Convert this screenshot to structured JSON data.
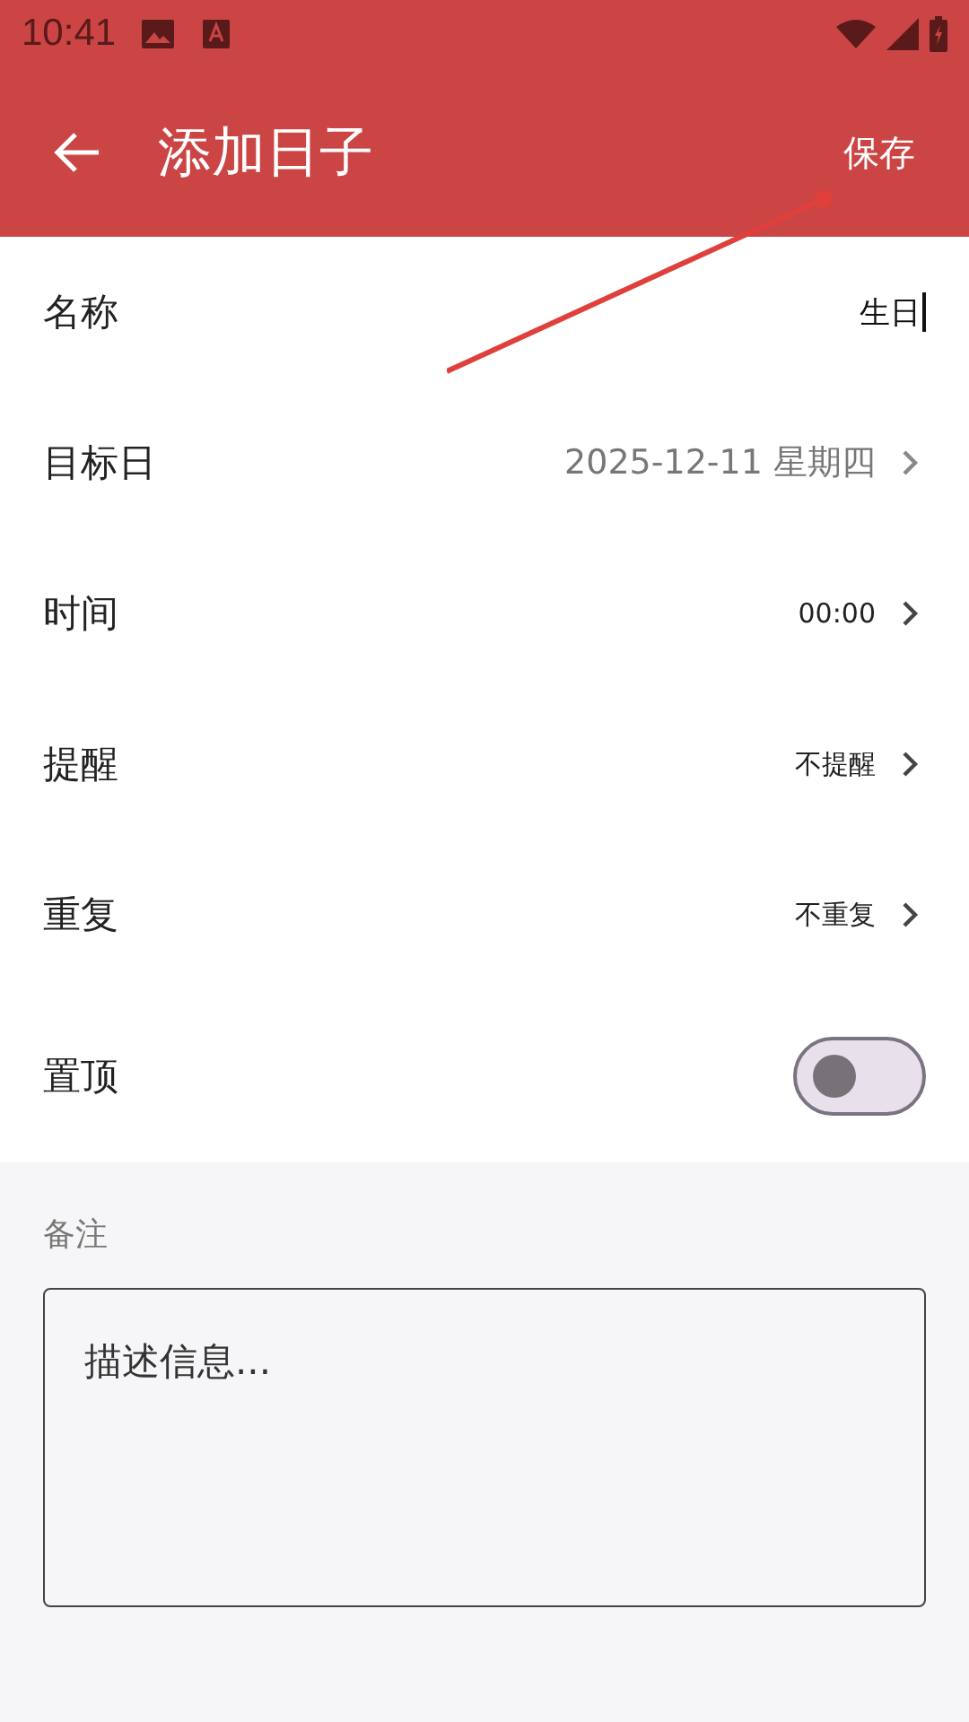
{
  "status_bar": {
    "time": "10:41"
  },
  "app_bar": {
    "title": "添加日子",
    "action": "保存"
  },
  "rows": [
    {
      "kind": "input",
      "label": "名称",
      "value": "生日"
    },
    {
      "kind": "date",
      "label": "目标日",
      "value": "2025-12-11 星期四"
    },
    {
      "kind": "picker",
      "label": "时间",
      "value": "00:00"
    },
    {
      "kind": "picker",
      "label": "提醒",
      "value": "不提醒"
    },
    {
      "kind": "picker",
      "label": "重复",
      "value": "不重复"
    },
    {
      "kind": "toggle",
      "label": "置顶",
      "on": false
    }
  ],
  "note": {
    "label": "备注",
    "placeholder": "描述信息..."
  }
}
